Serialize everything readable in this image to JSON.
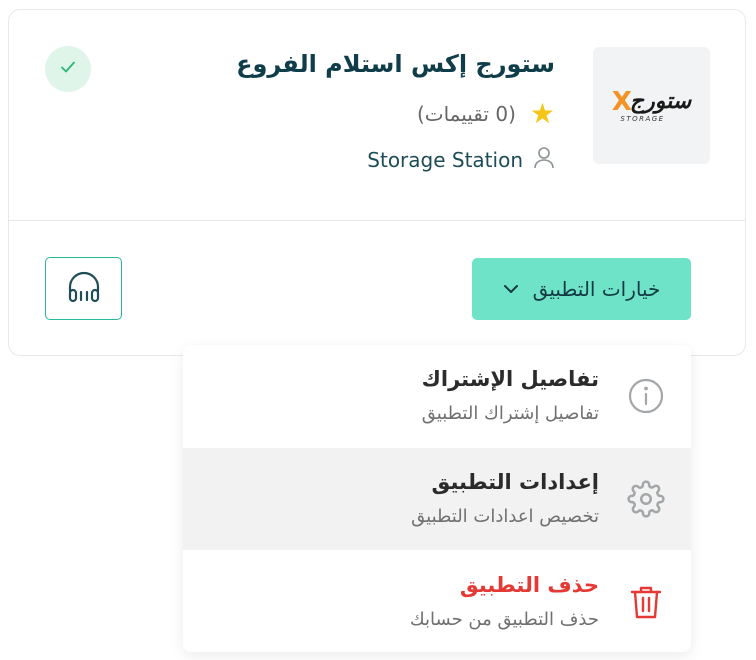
{
  "app": {
    "title": "ستورج إكس استلام الفروع",
    "rating_text": "(0 تقييمات)",
    "developer": "Storage Station",
    "logo_text_ar": "ستورج",
    "logo_text_x": "X",
    "logo_sub": "STORAGE"
  },
  "actions": {
    "options_label": "خيارات التطبيق"
  },
  "menu": {
    "items": [
      {
        "title": "تفاصيل الإشتراك",
        "subtitle": "تفاصيل إشتراك التطبيق",
        "icon": "info-icon"
      },
      {
        "title": "إعدادات التطبيق",
        "subtitle": "تخصيص اعدادات التطبيق",
        "icon": "gear-icon"
      },
      {
        "title": "حذف التطبيق",
        "subtitle": "حذف التطبيق من حسابك",
        "icon": "trash-icon"
      }
    ]
  },
  "colors": {
    "accent": "#6fe3c7",
    "accent_border": "#2bb89a",
    "title": "#0f3d4a",
    "danger": "#e53935",
    "star": "#f5c518",
    "verified_bg": "#dff5ea"
  }
}
